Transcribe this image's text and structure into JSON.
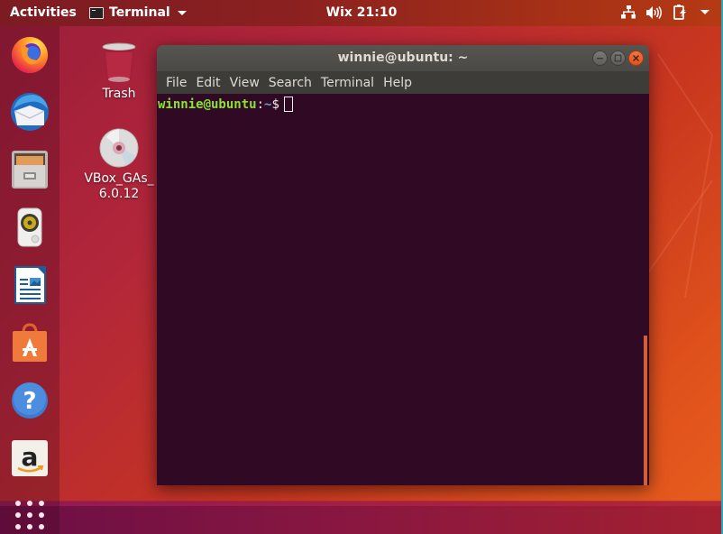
{
  "topbar": {
    "activities_label": "Activities",
    "app_menu_label": "Terminal",
    "clock": "Wix 21:10",
    "tray_icons": [
      "network-icon",
      "volume-icon",
      "battery-icon",
      "system-menu-caret-icon"
    ]
  },
  "dock": {
    "items": [
      {
        "name": "firefox",
        "icon": "firefox-icon"
      },
      {
        "name": "thunderbird",
        "icon": "thunderbird-mail-icon"
      },
      {
        "name": "files",
        "icon": "file-cabinet-icon"
      },
      {
        "name": "rhythmbox",
        "icon": "speaker-icon"
      },
      {
        "name": "libreoffice-writer",
        "icon": "writer-document-icon"
      },
      {
        "name": "ubuntu-software",
        "icon": "shopping-bag-icon"
      },
      {
        "name": "help",
        "icon": "help-question-icon"
      },
      {
        "name": "amazon",
        "icon": "amazon-icon"
      }
    ],
    "show_apps_icon": "apps-grid-icon"
  },
  "desktop": {
    "icons": [
      {
        "label": "Trash",
        "icon": "trash-icon"
      },
      {
        "label_line1": "VBox_GAs_",
        "label_line2": "6.0.12",
        "icon": "cd-disc-icon"
      }
    ]
  },
  "terminal": {
    "title": "winnie@ubuntu: ~",
    "menu": [
      "File",
      "Edit",
      "View",
      "Search",
      "Terminal",
      "Help"
    ],
    "prompt_user_host": "winnie@ubuntu",
    "prompt_sep": ":",
    "prompt_path": "~",
    "prompt_symbol": "$",
    "colors": {
      "background": "#300a24",
      "user_host": "#8ae234",
      "path": "#729fcf",
      "scrollbar": "#d1603a"
    }
  }
}
